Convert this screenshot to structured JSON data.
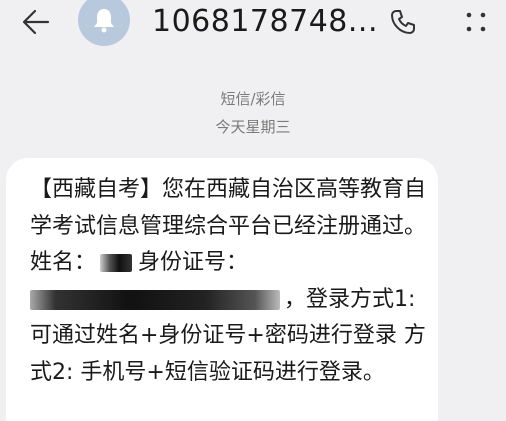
{
  "header": {
    "back_icon": "arrow-left-icon",
    "avatar_icon": "bell-person-icon",
    "contact": "1068178748...",
    "call_icon": "phone-icon",
    "more_icon": "more-vertical-icon"
  },
  "thread": {
    "message_type": "短信/彩信",
    "date": "今天星期三"
  },
  "message": {
    "part1": "【西藏自考】您在西藏自治区高等教育自学考试信息管理综合平台已经注册通过。姓名：",
    "part2": "身份证号：",
    "part3": "，登录方式1: 可通过姓名+身份证号+密码进行登录 方式2: 手机号+短信验证码进行登录。"
  },
  "colors": {
    "background": "#f0f0f2",
    "bubble": "#ffffff",
    "avatar": "#b8c8dd",
    "text": "#1a1a1a",
    "meta_text": "#7a7a7a"
  }
}
